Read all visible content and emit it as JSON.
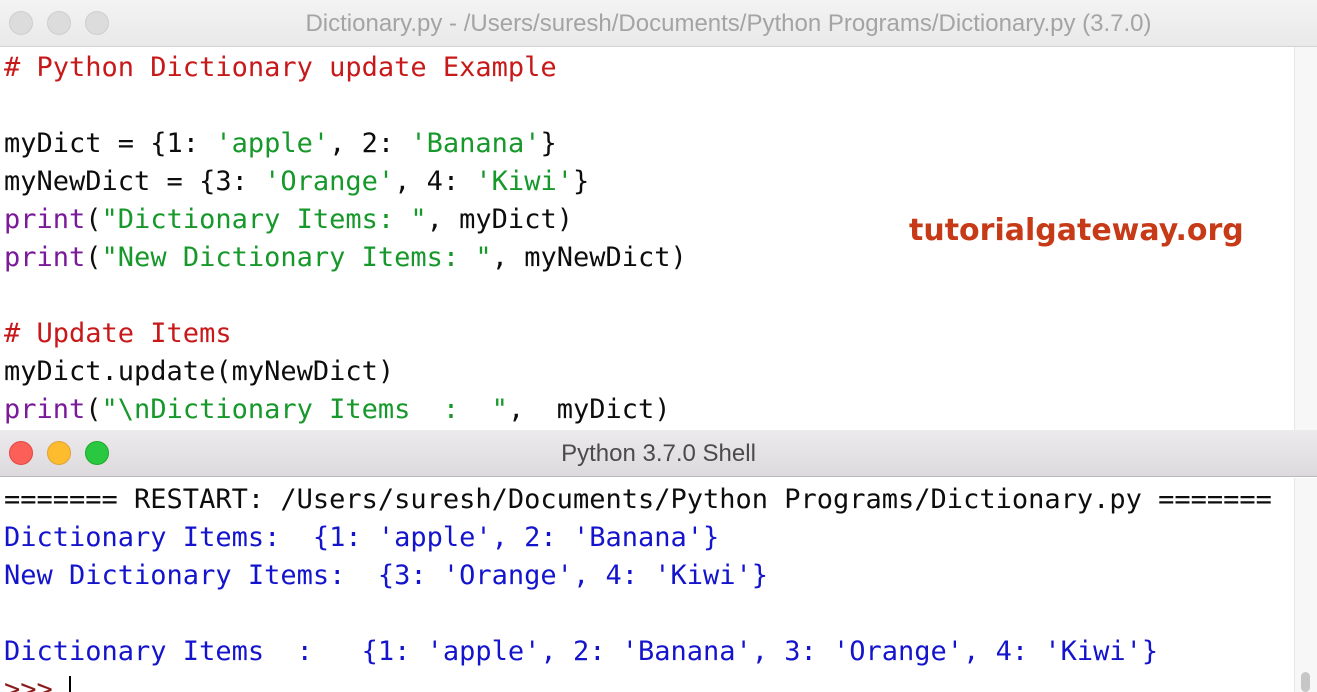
{
  "editor": {
    "title": "Dictionary.py - /Users/suresh/Documents/Python Programs/Dictionary.py (3.7.0)",
    "lines": [
      [
        {
          "t": "# Python Dictionary update Example",
          "c": "c"
        }
      ],
      [],
      [
        {
          "t": "myDict = {1: ",
          "c": "n"
        },
        {
          "t": "'apple'",
          "c": "s"
        },
        {
          "t": ", 2: ",
          "c": "n"
        },
        {
          "t": "'Banana'",
          "c": "s"
        },
        {
          "t": "}",
          "c": "n"
        }
      ],
      [
        {
          "t": "myNewDict = {3: ",
          "c": "n"
        },
        {
          "t": "'Orange'",
          "c": "s"
        },
        {
          "t": ", 4: ",
          "c": "n"
        },
        {
          "t": "'Kiwi'",
          "c": "s"
        },
        {
          "t": "}",
          "c": "n"
        }
      ],
      [
        {
          "t": "print",
          "c": "k"
        },
        {
          "t": "(",
          "c": "n"
        },
        {
          "t": "\"Dictionary Items: \"",
          "c": "s"
        },
        {
          "t": ", myDict)",
          "c": "n"
        }
      ],
      [
        {
          "t": "print",
          "c": "k"
        },
        {
          "t": "(",
          "c": "n"
        },
        {
          "t": "\"New Dictionary Items: \"",
          "c": "s"
        },
        {
          "t": ", myNewDict)",
          "c": "n"
        }
      ],
      [],
      [
        {
          "t": "# Update Items",
          "c": "c"
        }
      ],
      [
        {
          "t": "myDict.update(myNewDict)",
          "c": "n"
        }
      ],
      [
        {
          "t": "print",
          "c": "k"
        },
        {
          "t": "(",
          "c": "n"
        },
        {
          "t": "\"\\nDictionary Items  :  \"",
          "c": "s"
        },
        {
          "t": ",  myDict)",
          "c": "n"
        }
      ]
    ]
  },
  "watermark": "tutorialgateway.org",
  "shell": {
    "title": "Python 3.7.0 Shell",
    "lines": [
      [
        {
          "t": "======= RESTART: /Users/suresh/Documents/Python Programs/Dictionary.py =======",
          "c": "n"
        }
      ],
      [
        {
          "t": "Dictionary Items:  {1: 'apple', 2: 'Banana'}",
          "c": "o"
        }
      ],
      [
        {
          "t": "New Dictionary Items:  {3: 'Orange', 4: 'Kiwi'}",
          "c": "o"
        }
      ],
      [],
      [
        {
          "t": "Dictionary Items  :   {1: 'apple', 2: 'Banana', 3: 'Orange', 4: 'Kiwi'}",
          "c": "o"
        }
      ]
    ],
    "prompt": ">>> "
  },
  "colors": {
    "comment": "#c8191a",
    "keyword": "#7a1a99",
    "string": "#16982a",
    "output": "#1414cc",
    "prompt": "#8b1b1b",
    "watermark": "#c73a17"
  }
}
